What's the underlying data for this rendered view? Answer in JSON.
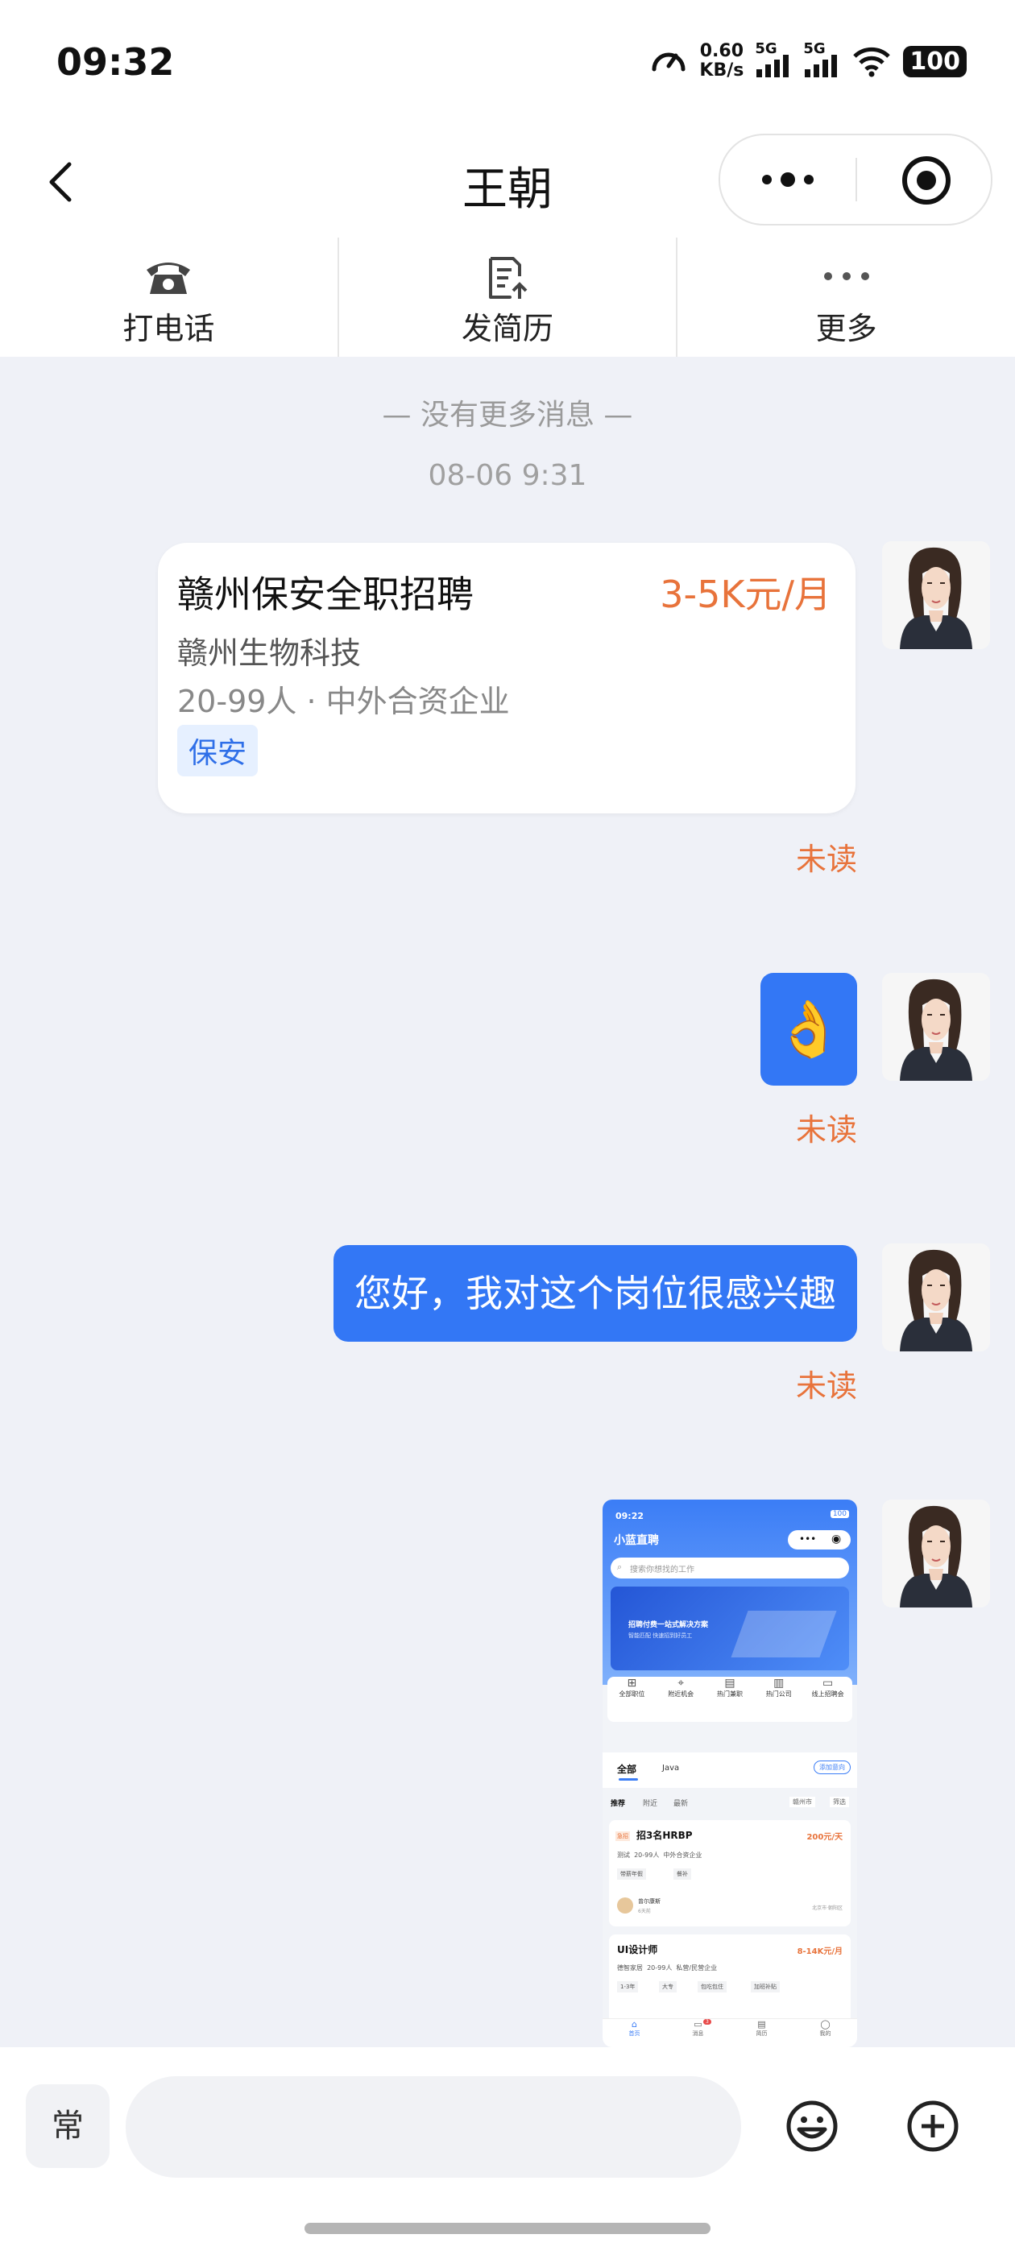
{
  "status_bar": {
    "time": "09:32",
    "speed_value": "0.60",
    "speed_unit": "KB/s",
    "network1": "5G",
    "network2": "5G",
    "battery": "100"
  },
  "header": {
    "title": "王朝"
  },
  "actions": [
    {
      "label": "打电话",
      "icon": "phone-icon"
    },
    {
      "label": "发简历",
      "icon": "resume-send-icon"
    },
    {
      "label": "更多",
      "icon": "more-dots-icon"
    }
  ],
  "chat": {
    "no_more": "— 没有更多消息 —",
    "timestamp": "08-06 9:31",
    "job_card": {
      "title": "赣州保安全职招聘",
      "salary": "3-5K元/月",
      "company": "赣州生物科技",
      "meta": "20-99人 · 中外合资企业",
      "tag": "保安"
    },
    "read_status": "未读",
    "emoji": "👌",
    "text_message": "您好，我对这个岗位很感兴趣"
  },
  "screenshot_message": {
    "time": "09:22",
    "battery": "100",
    "app_title": "小蓝直聘",
    "search_placeholder": "搜索你想找的工作",
    "banner_title": "招聘付费一站式解决方案",
    "banner_sub": "智能匹配 快速招到好员工",
    "categories": [
      "全部职位",
      "附近机会",
      "热门兼职",
      "热门公司",
      "线上招聘会"
    ],
    "tabs": [
      "全部",
      "Java"
    ],
    "add_intent": "添加意向",
    "subtabs": [
      "推荐",
      "附近",
      "最新"
    ],
    "filters": [
      "赣州市",
      "筛选"
    ],
    "job1": {
      "badge": "急招",
      "title": "招3名HRBP",
      "salary": "200元/天",
      "meta": "测试  20-99人  中外合资企业",
      "tags": [
        "带薪年假",
        "餐补"
      ],
      "recruiter": "曾尔康斯",
      "recruiter_time": "6天前",
      "location": "北京市·朝阳区"
    },
    "job2": {
      "title": "UI设计师",
      "salary": "8-14K元/月",
      "meta": "德智家居  20-99人  私营/民营企业",
      "tags": [
        "1-3年",
        "大专",
        "包吃包住",
        "加班补贴"
      ]
    },
    "nav": [
      "首页",
      "消息",
      "简历",
      "我的"
    ],
    "nav_badge": "3",
    "colors": {
      "primary": "#3377f5",
      "salary": "#e8733b"
    }
  },
  "input_bar": {
    "quick_reply": "常",
    "message_value": ""
  }
}
